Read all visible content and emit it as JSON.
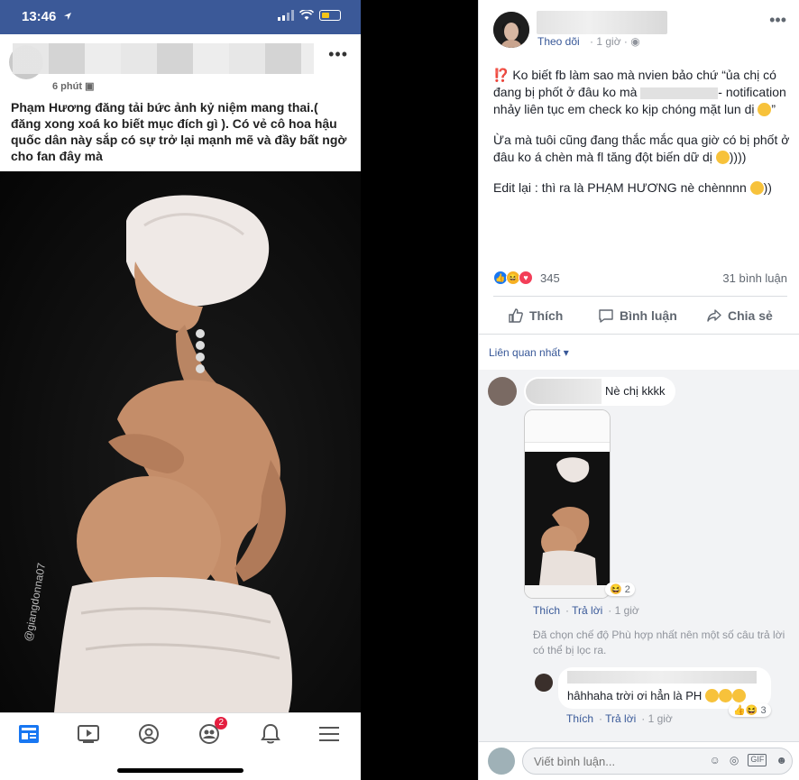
{
  "phone": {
    "status_time": "13:46",
    "post_time": "6 phút",
    "post_text": "Phạm Hương đăng tải bức ảnh kỷ niệm mang thai.( đăng xong xoá ko biết mục đích gì ). Có vẻ cô hoa hậu quốc dân này sắp có sự trở lại mạnh mẽ và đầy bất ngờ cho fan đây mà",
    "watermark": "@giangdonna07",
    "nav_badge": "2"
  },
  "post": {
    "follow_label": "Theo dõi",
    "time": "1 giờ",
    "paragraph1_a": "Ko biết fb làm sao mà nvien bảo chứ “ủa chị có đang bị phốt ở đâu ko mà",
    "paragraph1_b": "- notification nhảy liên tục em check ko kịp chóng mặt lun dị",
    "paragraph1_c": "”",
    "paragraph2": "Ừa mà tuôi cũng đang thắc mắc qua giờ có bị phốt ở đâu ko á chèn mà fl tăng đột biến dữ dị",
    "paragraph2_end": "))))",
    "paragraph3": "Edit lại : thì ra là PHẠM HƯƠNG nè chènnnn",
    "paragraph3_end": "))",
    "reaction_count": "345",
    "comment_count": "31 bình luận",
    "like_label": "Thích",
    "comment_label": "Bình luận",
    "share_label": "Chia sẻ",
    "sort_label": "Liên quan nhất"
  },
  "comments": {
    "c1_text": "Nè chị kkkk",
    "c1_reaction_count": "2",
    "c1_like": "Thích",
    "c1_reply": "Trả lời",
    "c1_time": "1 giờ",
    "filter_note": "Đã chọn chế độ Phù hợp nhất nên một số câu trả lời có thể bị lọc ra.",
    "r1_text": "hâhhaha trời ơi hẳn là PH",
    "r1_reaction_count": "3",
    "r1_like": "Thích",
    "r1_reply": "Trả lời",
    "r1_time": "1 giờ",
    "write_placeholder": "Viết bình luận..."
  }
}
